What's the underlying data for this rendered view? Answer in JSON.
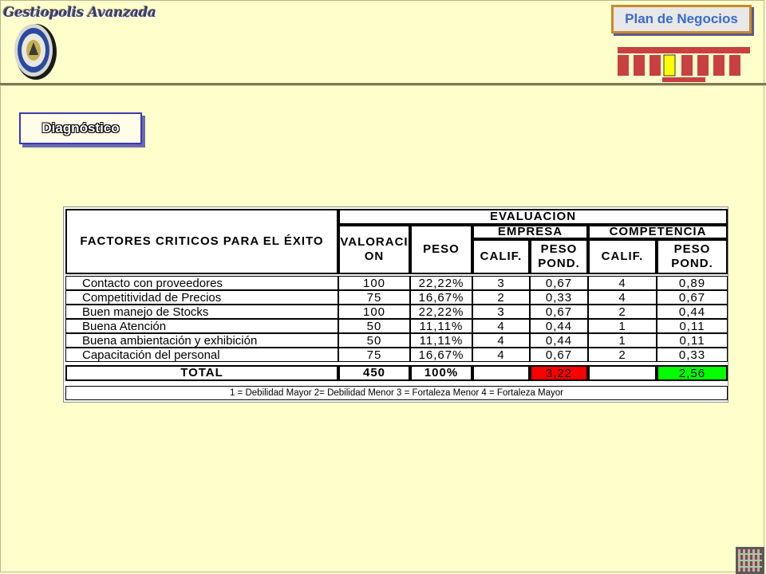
{
  "header": {
    "logo_text": "Gestiopolis Avanzada",
    "plan_button": "Plan de Negocios"
  },
  "section_button": "Diagnóstico",
  "table": {
    "factor_header": "FACTORES CRITICOS PARA EL ÉXITO",
    "evaluacion": "EVALUACION",
    "valoracion": "VALORACION",
    "peso": "PESO",
    "empresa": "EMPRESA",
    "competencia": "COMPETENCIA",
    "calif": "CALIF.",
    "peso_pond": "PESO POND.",
    "rows": [
      {
        "factor": "Contacto con proveedores",
        "valoracion": "100",
        "peso": "22,22%",
        "emp_calif": "3",
        "emp_pond": "0,67",
        "comp_calif": "4",
        "comp_pond": "0,89"
      },
      {
        "factor": "Competitividad de Precios",
        "valoracion": "75",
        "peso": "16,67%",
        "emp_calif": "2",
        "emp_pond": "0,33",
        "comp_calif": "4",
        "comp_pond": "0,67"
      },
      {
        "factor": "Buen manejo de Stocks",
        "valoracion": "100",
        "peso": "22,22%",
        "emp_calif": "3",
        "emp_pond": "0,67",
        "comp_calif": "2",
        "comp_pond": "0,44"
      },
      {
        "factor": "Buena Atención",
        "valoracion": "50",
        "peso": "11,11%",
        "emp_calif": "4",
        "emp_pond": "0,44",
        "comp_calif": "1",
        "comp_pond": "0,11"
      },
      {
        "factor": "Buena ambientación y exhibición",
        "valoracion": "50",
        "peso": "11,11%",
        "emp_calif": "4",
        "emp_pond": "0,44",
        "comp_calif": "1",
        "comp_pond": "0,11"
      },
      {
        "factor": "Capacitación del personal",
        "valoracion": "75",
        "peso": "16,67%",
        "emp_calif": "4",
        "emp_pond": "0,67",
        "comp_calif": "2",
        "comp_pond": "0,33"
      }
    ],
    "total": {
      "label": "TOTAL",
      "valoracion": "450",
      "peso": "100%",
      "emp_pond": "3,22",
      "comp_pond": "2,56"
    },
    "footnote": "1 = Debilidad Mayor 2= Debilidad Menor  3 = Fortaleza Menor 4 = Fortaleza Mayor"
  },
  "colors": {
    "background": "#ffffcc",
    "empresa_total": "#ff0000",
    "competencia_total": "#00ff00",
    "plan_text": "#3a6ad0"
  }
}
